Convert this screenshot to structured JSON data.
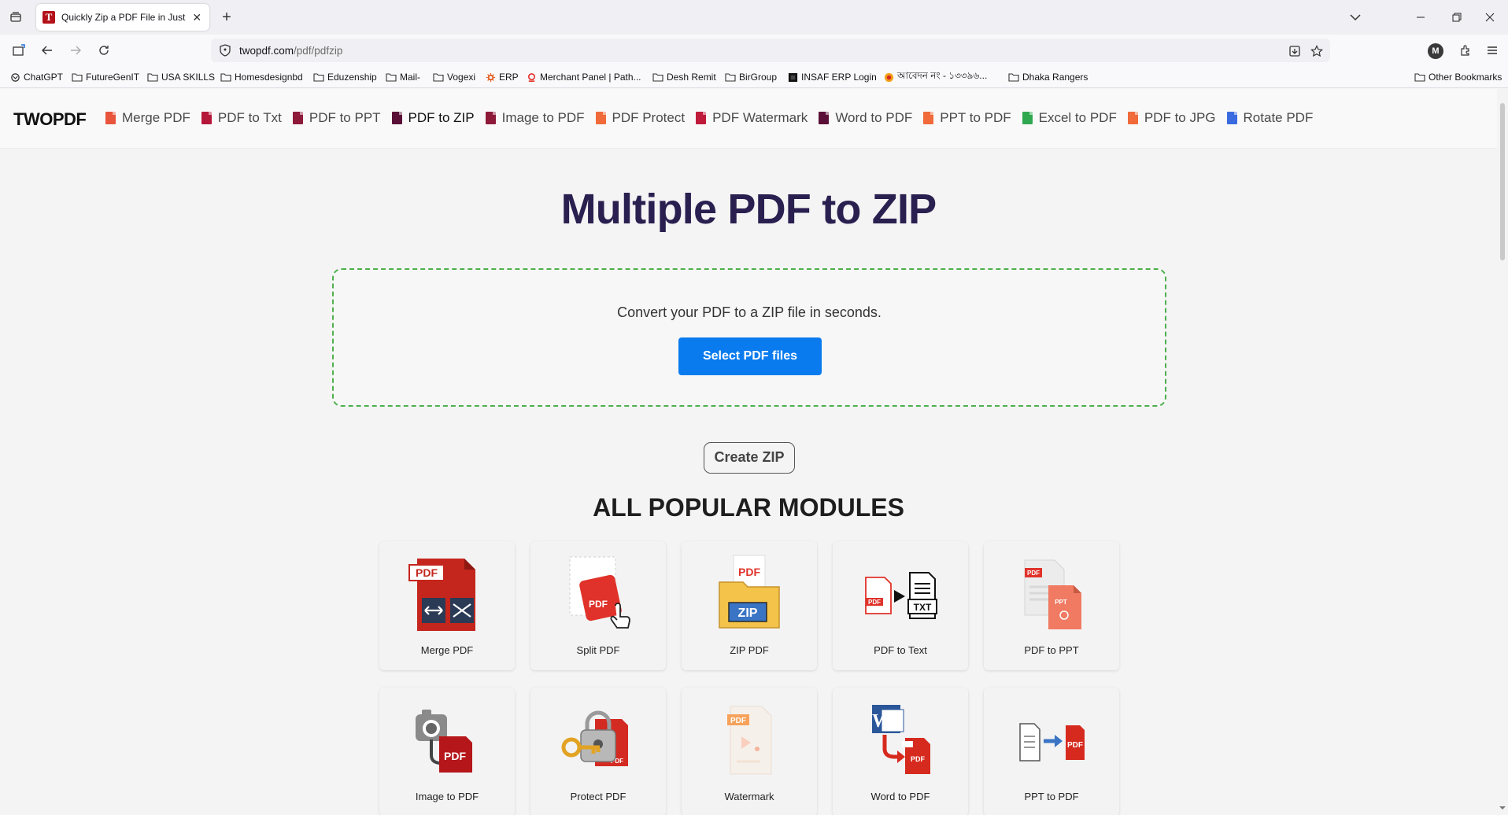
{
  "browser": {
    "tab_title": "Quickly Zip a PDF File in Just a F",
    "url_host": "twopdf.com",
    "url_path": "/pdf/pdfzip",
    "profile_initial": "M",
    "bookmarks": [
      {
        "label": "ChatGPT",
        "icon": "openai-icon"
      },
      {
        "label": "FutureGenIT",
        "icon": "folder-icon"
      },
      {
        "label": "USA SKILLS",
        "icon": "folder-icon"
      },
      {
        "label": "Homesdesignbd",
        "icon": "folder-icon"
      },
      {
        "label": "Eduzenship",
        "icon": "folder-icon"
      },
      {
        "label": "Mail-",
        "icon": "folder-icon"
      },
      {
        "label": "Vogexi",
        "icon": "folder-icon"
      },
      {
        "label": "ERP",
        "icon": "gear-icon"
      },
      {
        "label": "Merchant Panel | Path...",
        "icon": "pathao-icon"
      },
      {
        "label": "Desh Remit",
        "icon": "folder-icon"
      },
      {
        "label": "BirGroup",
        "icon": "folder-icon"
      },
      {
        "label": "INSAF ERP Login",
        "icon": "insaf-icon"
      },
      {
        "label": "আবেদন নং - ১৩৩৯৬...",
        "icon": "circle-logo-icon"
      },
      {
        "label": "Dhaka Rangers",
        "icon": "folder-icon"
      }
    ],
    "other_bookmarks": "Other Bookmarks"
  },
  "site": {
    "logo": "TWOPDF",
    "menu": [
      {
        "label": "Merge PDF",
        "color": "#e8543c"
      },
      {
        "label": "PDF to Txt",
        "color": "#b5173a"
      },
      {
        "label": "PDF to PPT",
        "color": "#8e1a3a"
      },
      {
        "label": "PDF to ZIP",
        "color": "#5a1036"
      },
      {
        "label": "Image to PDF",
        "color": "#8e1a3a"
      },
      {
        "label": "PDF Protect",
        "color": "#f06a3a"
      },
      {
        "label": "PDF Watermark",
        "color": "#c01a3a"
      },
      {
        "label": "Word to PDF",
        "color": "#5a1036"
      },
      {
        "label": "PPT to PDF",
        "color": "#f06a3a"
      },
      {
        "label": "Excel to PDF",
        "color": "#2fa84f"
      },
      {
        "label": "PDF to JPG",
        "color": "#f06a3a"
      },
      {
        "label": "Rotate PDF",
        "color": "#3a6ae0"
      }
    ],
    "active_menu": "PDF to ZIP"
  },
  "main": {
    "title": "Multiple PDF to ZIP",
    "dropzone_text": "Convert your PDF to a ZIP file in seconds.",
    "select_button": "Select PDF files",
    "create_button": "Create ZIP",
    "modules_title": "ALL POPULAR MODULES",
    "modules": [
      {
        "label": "Merge PDF",
        "icon": "merge-pdf-icon"
      },
      {
        "label": "Split PDF",
        "icon": "split-pdf-icon"
      },
      {
        "label": "ZIP PDF",
        "icon": "zip-pdf-icon"
      },
      {
        "label": "PDF to Text",
        "icon": "pdf-to-text-icon"
      },
      {
        "label": "PDF to PPT",
        "icon": "pdf-to-ppt-icon"
      },
      {
        "label": "Image to PDF",
        "icon": "image-to-pdf-icon"
      },
      {
        "label": "Protect PDF",
        "icon": "protect-pdf-icon"
      },
      {
        "label": "Watermark",
        "icon": "watermark-icon"
      },
      {
        "label": "Word to PDF",
        "icon": "word-to-pdf-icon"
      },
      {
        "label": "PPT to PDF",
        "icon": "ppt-to-pdf-icon"
      }
    ]
  }
}
